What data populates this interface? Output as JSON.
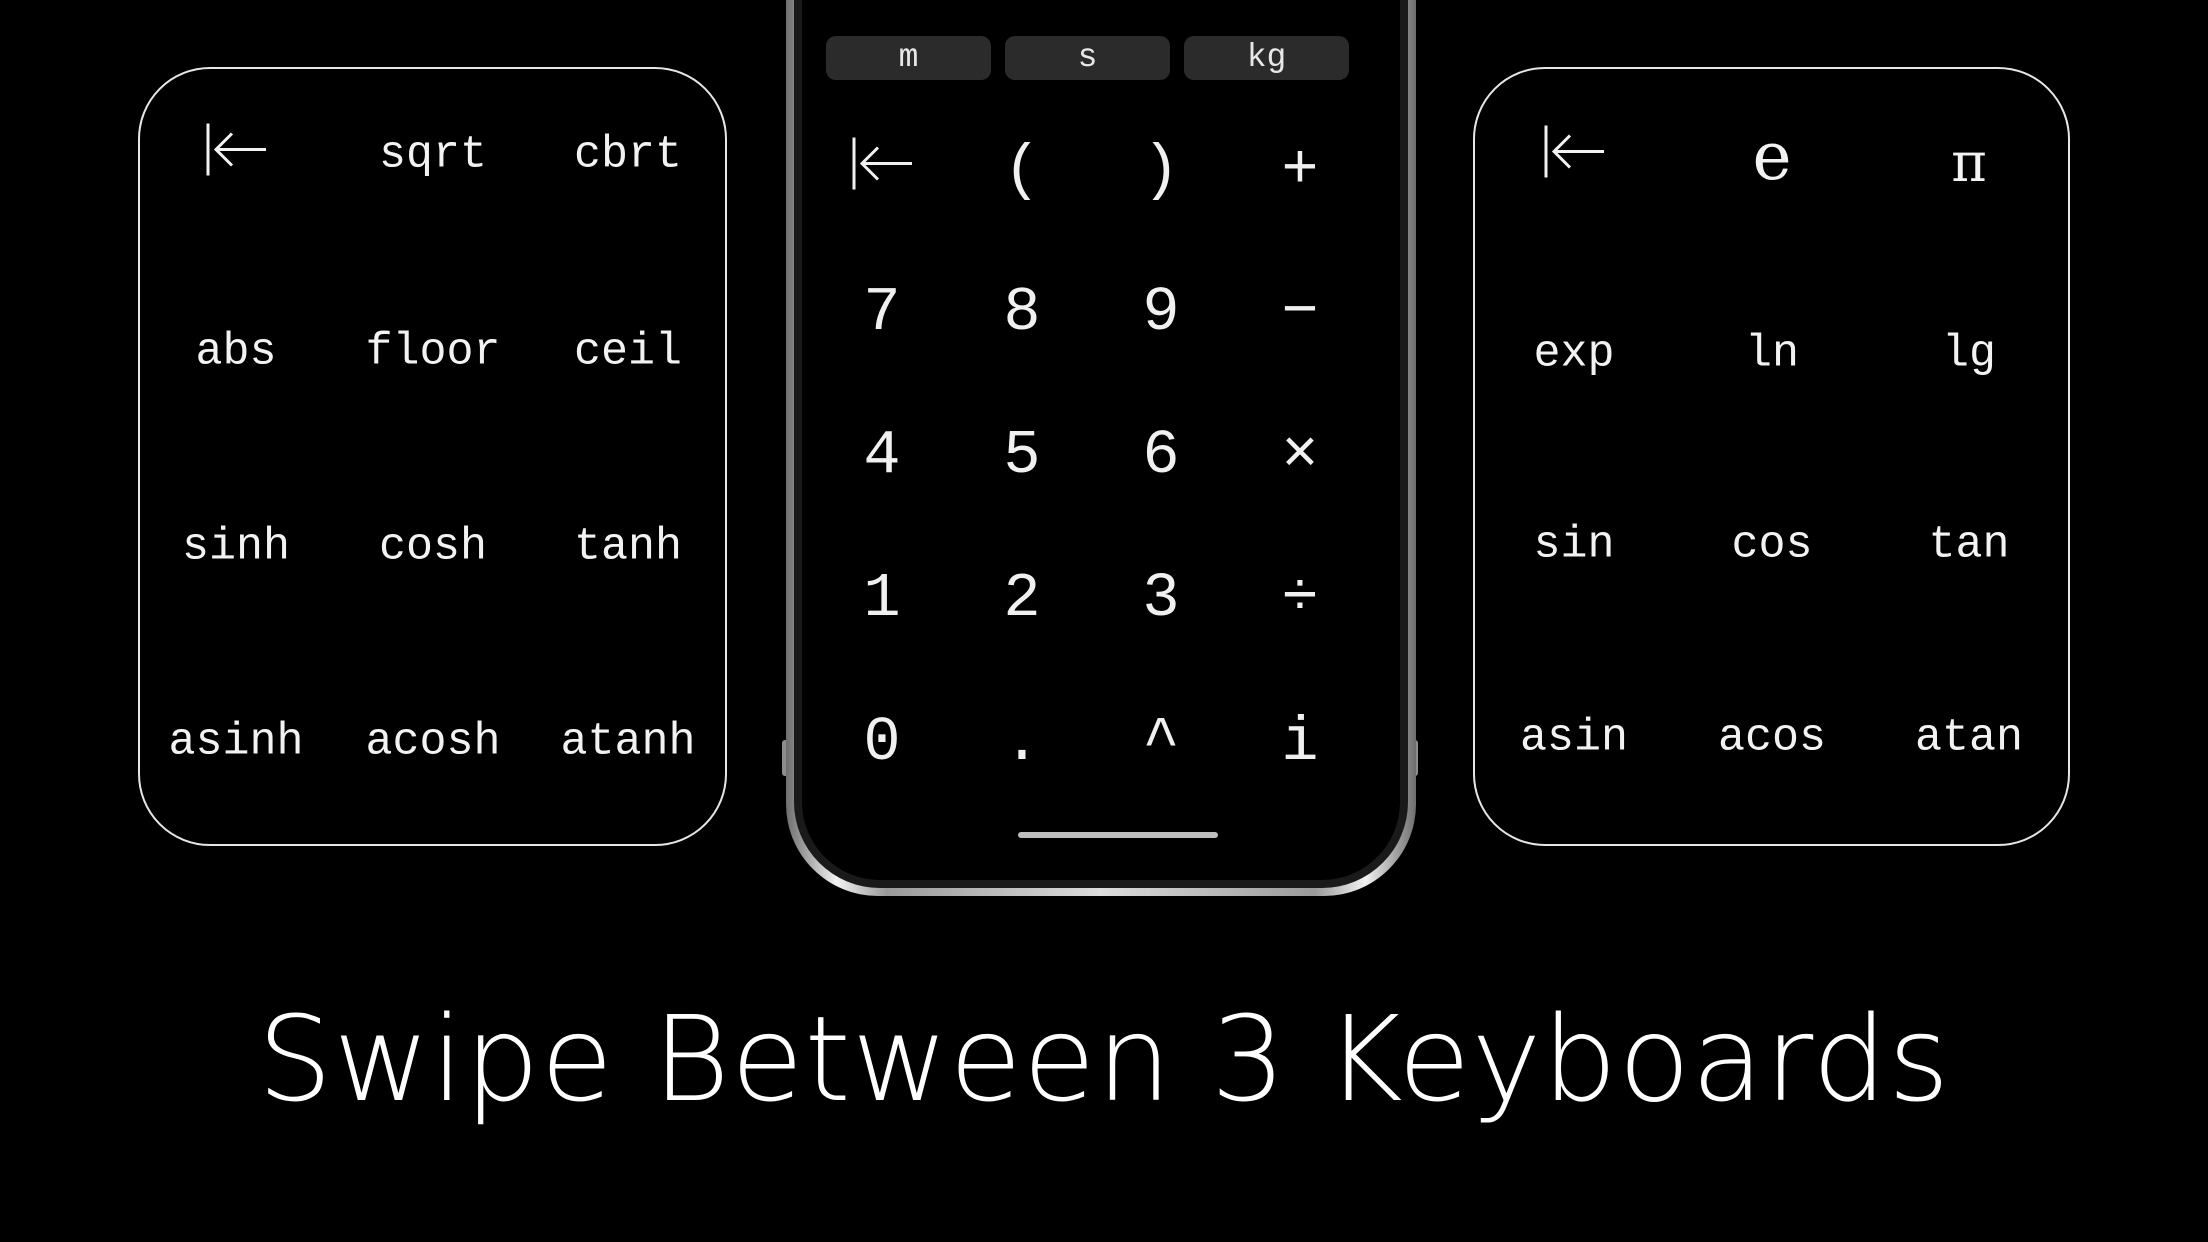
{
  "left_keyboard": {
    "rows": [
      [
        "backspace-icon",
        "sqrt",
        "cbrt"
      ],
      [
        "abs",
        "floor",
        "ceil"
      ],
      [
        "sinh",
        "cosh",
        "tanh"
      ],
      [
        "asinh",
        "acosh",
        "atanh"
      ]
    ],
    "labels": {
      "sqrt": "sqrt",
      "cbrt": "cbrt",
      "abs": "abs",
      "floor": "floor",
      "ceil": "ceil",
      "sinh": "sinh",
      "cosh": "cosh",
      "tanh": "tanh",
      "asinh": "asinh",
      "acosh": "acosh",
      "atanh": "atanh"
    }
  },
  "center_keyboard": {
    "units": [
      "m",
      "s",
      "kg"
    ],
    "row1": [
      "(",
      ")",
      "+"
    ],
    "row2": [
      "7",
      "8",
      "9",
      "−"
    ],
    "row3": [
      "4",
      "5",
      "6",
      "×"
    ],
    "row4": [
      "1",
      "2",
      "3",
      "÷"
    ],
    "row5": [
      "0",
      ".",
      "^",
      "i"
    ]
  },
  "right_keyboard": {
    "e": "e",
    "pi": "π",
    "exp": "exp",
    "ln": "ln",
    "lg": "lg",
    "sin": "sin",
    "cos": "cos",
    "tan": "tan",
    "asin": "asin",
    "acos": "acos",
    "atan": "atan"
  },
  "caption": "Swipe Between 3 Keyboards",
  "colors": {
    "background": "#000000",
    "foreground": "#ffffff",
    "chip": "#2b2b2b"
  },
  "icons": {
    "backspace": "tab-left-arrow-icon"
  }
}
